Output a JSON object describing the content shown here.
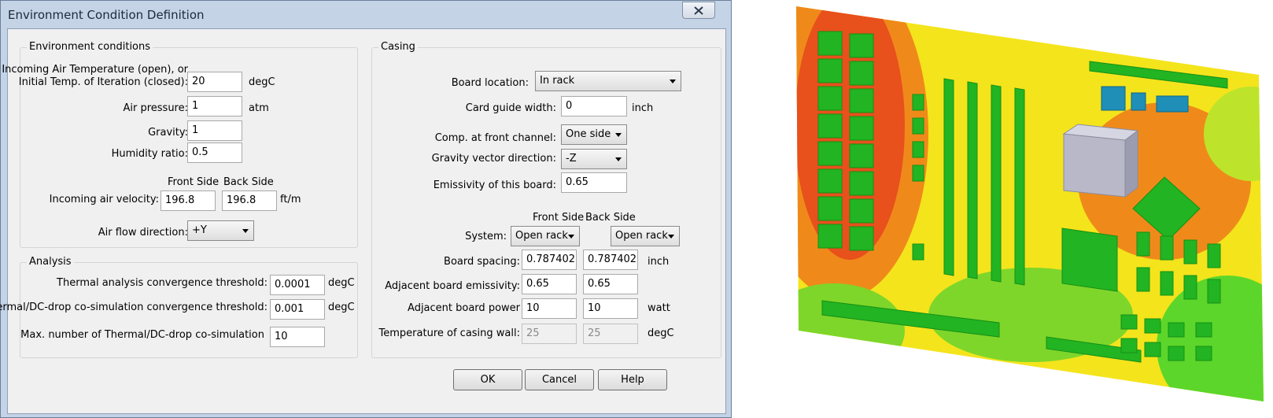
{
  "window": {
    "title": "Environment Condition Definition"
  },
  "env": {
    "legend": "Environment conditions",
    "temp_label_1": "Incoming Air Temperature (open), or",
    "temp_label_2": "Initial Temp. of Iteration (closed):",
    "temp_value": "20",
    "temp_unit": "degC",
    "pressure_label": "Air pressure:",
    "pressure_value": "1",
    "pressure_unit": "atm",
    "gravity_label": "Gravity:",
    "gravity_value": "1",
    "humidity_label": "Humidity ratio:",
    "humidity_value": "0.5",
    "front_side": "Front Side",
    "back_side": "Back Side",
    "velocity_label": "Incoming air velocity:",
    "velocity_front": "196.8",
    "velocity_back": "196.8",
    "velocity_unit": "ft/m",
    "airflow_label": "Air flow direction:",
    "airflow_value": "+Y"
  },
  "analysis": {
    "legend": "Analysis",
    "thermal_label": "Thermal analysis convergence threshold:",
    "thermal_value": "0.0001",
    "thermal_unit": "degC",
    "cosim_label": "Thermal/DC-drop co-simulation convergence threshold:",
    "cosim_value": "0.001",
    "cosim_unit": "degC",
    "max_label": "Max. number of Thermal/DC-drop co-simulation",
    "max_value": "10"
  },
  "casing": {
    "legend": "Casing",
    "board_location_label": "Board location:",
    "board_location_value": "In rack",
    "card_guide_label": "Card guide width:",
    "card_guide_value": "0",
    "card_guide_unit": "inch",
    "comp_front_label": "Comp. at front channel:",
    "comp_front_value": "One side",
    "gravity_dir_label": "Gravity vector direction:",
    "gravity_dir_value": "-Z",
    "emissivity_label": "Emissivity of this board:",
    "emissivity_value": "0.65",
    "front_side": "Front Side",
    "back_side": "Back Side",
    "system_label": "System:",
    "system_front": "Open rack",
    "system_back": "Open rack",
    "spacing_label": "Board spacing:",
    "spacing_front": "0.787402",
    "spacing_back": "0.787402",
    "spacing_unit": "inch",
    "adj_emis_label": "Adjacent board emissivity:",
    "adj_emis_front": "0.65",
    "adj_emis_back": "0.65",
    "adj_power_label": "Adjacent board power",
    "adj_power_front": "10",
    "adj_power_back": "10",
    "adj_power_unit": "watt",
    "wall_temp_label": "Temperature of casing wall:",
    "wall_temp_front": "25",
    "wall_temp_back": "25",
    "wall_temp_unit": "degC"
  },
  "buttons": {
    "ok": "OK",
    "cancel": "Cancel",
    "help": "Help"
  },
  "colors": {
    "hot": "#e8201c",
    "warm": "#f07e1c",
    "mid": "#f6e81c",
    "cool": "#5cd62a",
    "cold": "#2a9b2a"
  },
  "icons": {
    "close": "close-icon",
    "dropdown": "chevron-down-icon"
  }
}
